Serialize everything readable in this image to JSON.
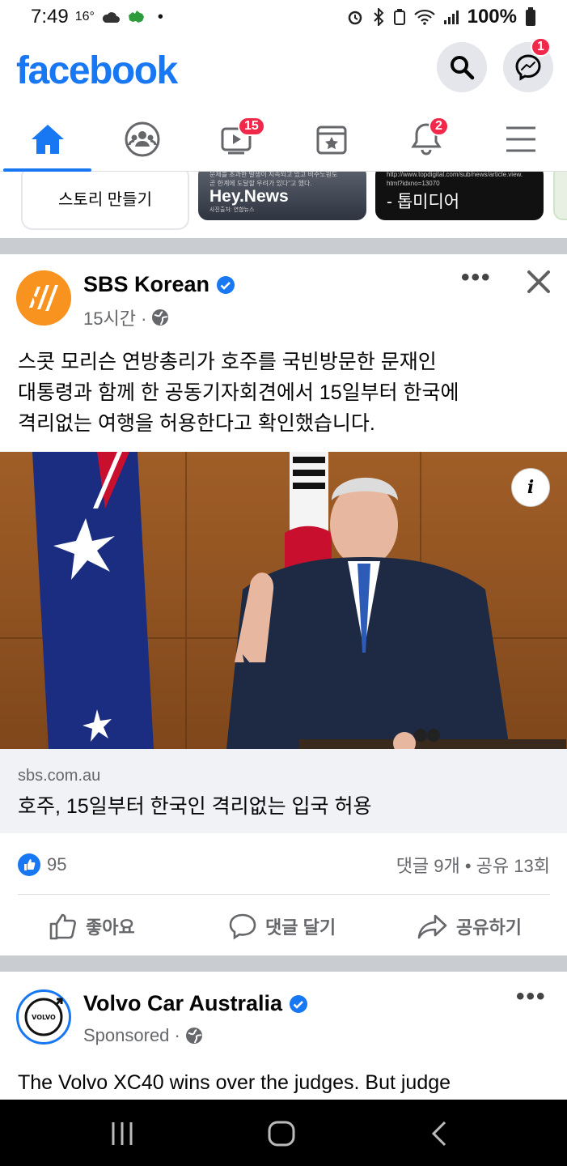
{
  "status_bar": {
    "time": "7:49",
    "temperature": "16°",
    "battery": "100%"
  },
  "header": {
    "logo": "facebook",
    "search_icon": "search-icon",
    "messenger_icon": "messenger-icon",
    "messenger_badge": "1"
  },
  "tabs": [
    {
      "name": "home",
      "icon": "home-icon",
      "active": true
    },
    {
      "name": "groups",
      "icon": "groups-icon"
    },
    {
      "name": "watch",
      "icon": "video-icon",
      "badge": "15"
    },
    {
      "name": "marketplace",
      "icon": "store-icon"
    },
    {
      "name": "notifications",
      "icon": "bell-icon",
      "badge": "2"
    },
    {
      "name": "menu",
      "icon": "hamburger-icon"
    }
  ],
  "stories": {
    "create_label": "스토리 만들기",
    "card1_small_1": "문제를 초과한 발생이 지속되고 있고 비주노원도",
    "card1_small_2": "곧 한계에 도달할 우려가 있다\"고 했다.",
    "card1_title": "Hey.News",
    "card1_caption": "사진출처: 연합뉴스",
    "card2_small_1": "http://www.topdigital.com/sub/news/article.view.",
    "card2_small_2": "html?idxno=13070",
    "card2_title": "- 톱미디어"
  },
  "post1": {
    "page_name": "SBS Korean",
    "time": "15시간 ·",
    "text_lines": [
      "스콧 모리슨 연방총리가 호주를 국빈방문한 문재인",
      "대통령과 함께 한 공동기자회견에서 15일부터 한국에",
      "격리없는 여행을 허용한다고 확인했습니다."
    ],
    "info_label": "i",
    "link_domain": "sbs.com.au",
    "link_title": "호주, 15일부터 한국인 격리없는 입국 허용",
    "like_count": "95",
    "comments_shares": "댓글 9개 • 공유 13회",
    "like_label": "좋아요",
    "comment_label": "댓글 달기",
    "share_label": "공유하기"
  },
  "post2": {
    "page_name": "Volvo Car Australia",
    "sponsored": "Sponsored ·",
    "logo_text": "VOLVO",
    "text": "The Volvo XC40 wins over the judges. But judge"
  },
  "colors": {
    "brand": "#1877f2",
    "badge": "#f02849",
    "muted": "#65676b",
    "separator": "#c9ccd1"
  }
}
